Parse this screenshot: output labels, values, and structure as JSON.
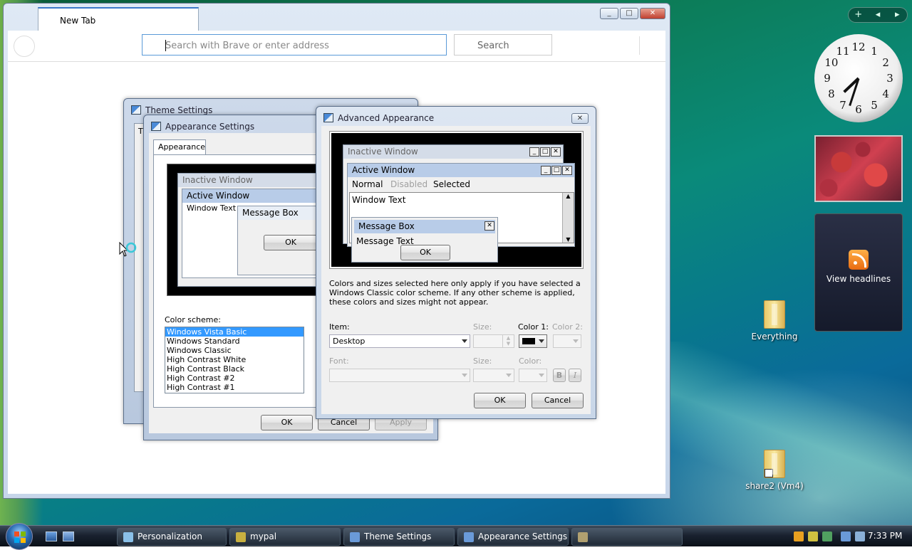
{
  "browser": {
    "tab_title": "New Tab",
    "address_placeholder": "Search with Brave or enter address",
    "search_label": "Search",
    "win_minimize": "_",
    "win_maximize": "□",
    "win_close": "✕"
  },
  "theme_settings": {
    "title": "Theme Settings",
    "tab_fragment": "T"
  },
  "appearance_settings": {
    "title": "Appearance Settings",
    "tab_label": "Appearance",
    "preview": {
      "inactive": "Inactive Window",
      "active": "Active Window",
      "window_text": "Window Text",
      "message_box": "Message Box",
      "ok": "OK"
    },
    "color_scheme_label": "Color scheme:",
    "color_schemes": [
      "Windows Vista Basic",
      "Windows Standard",
      "Windows Classic",
      "High Contrast White",
      "High Contrast Black",
      "High Contrast #2",
      "High Contrast #1"
    ],
    "selected_scheme": "Windows Vista Basic",
    "ok": "OK",
    "cancel": "Cancel",
    "apply": "Apply"
  },
  "advanced_appearance": {
    "title": "Advanced Appearance",
    "close_glyph": "✕",
    "preview": {
      "inactive": "Inactive Window",
      "active": "Active Window",
      "menu_normal": "Normal",
      "menu_disabled": "Disabled",
      "menu_selected": "Selected",
      "window_text": "Window Text",
      "message_box": "Message Box",
      "message_text": "Message Text",
      "ok": "OK"
    },
    "note": "Colors and sizes selected here only apply if you have selected a Windows Classic color scheme. If any other scheme is applied, these colors and sizes might not appear.",
    "item_label": "Item:",
    "item_value": "Desktop",
    "size_label": "Size:",
    "color1_label": "Color 1:",
    "color2_label": "Color 2:",
    "font_label": "Font:",
    "font_size_label": "Size:",
    "font_color_label": "Color:",
    "bold": "B",
    "italic": "I",
    "ok": "OK",
    "cancel": "Cancel",
    "color1_value_hex": "#000000"
  },
  "sidebar": {
    "add": "+",
    "prev": "◂",
    "next": "▸",
    "clock_time": {
      "hour": 7,
      "minute": 33
    },
    "feed_label": "View headlines"
  },
  "desktop_icons": [
    {
      "label": "Everything"
    },
    {
      "label": "share2 (Vm4)"
    }
  ],
  "taskbar": {
    "items": [
      {
        "label": "Personalization"
      },
      {
        "label": "mypal"
      },
      {
        "label": "Theme Settings"
      },
      {
        "label": "Appearance Settings"
      },
      {
        "label": ""
      }
    ],
    "time": "7:33 PM"
  }
}
